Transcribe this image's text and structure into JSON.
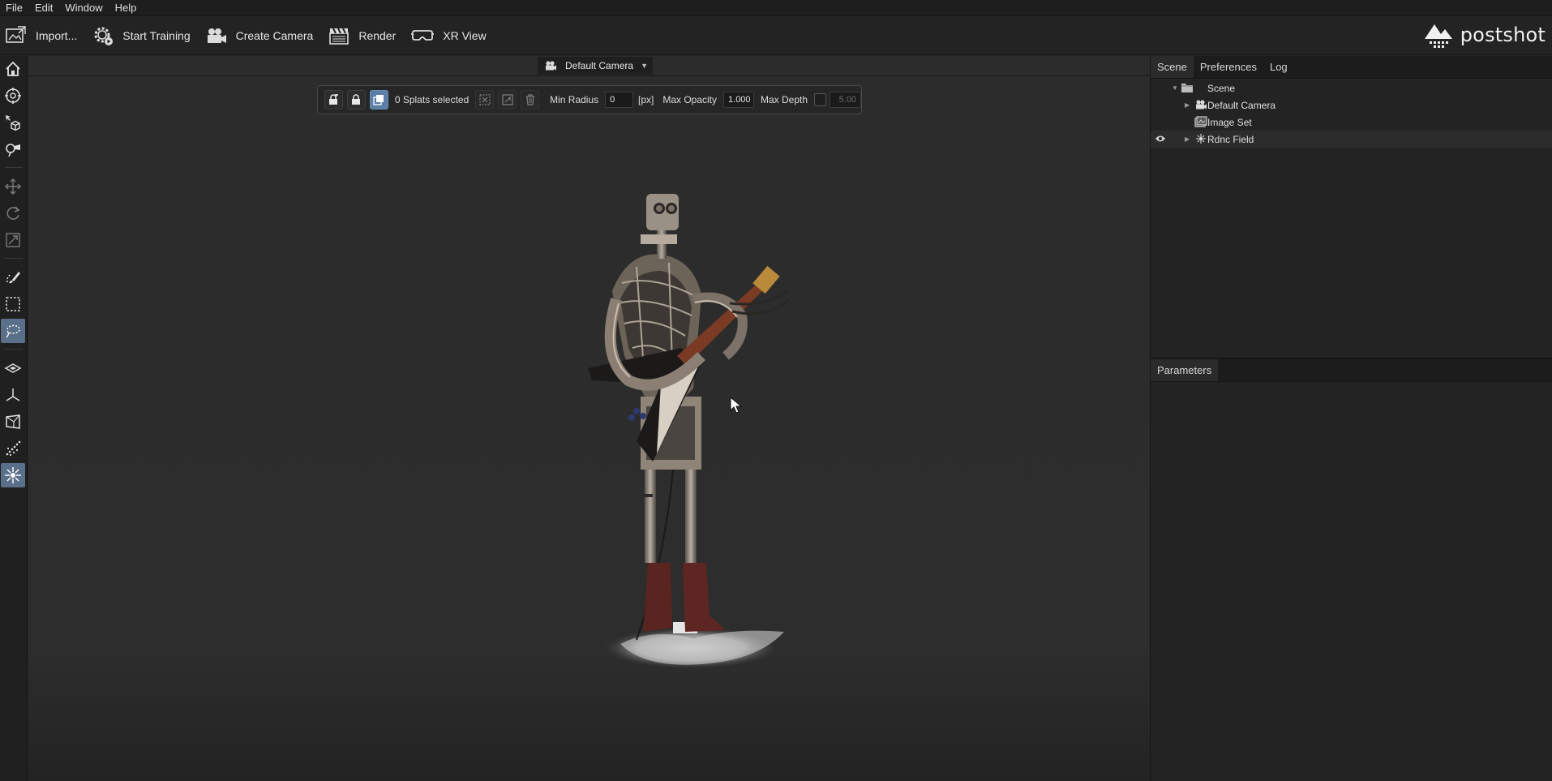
{
  "menu": [
    "File",
    "Edit",
    "Window",
    "Help"
  ],
  "toolbar": {
    "import": "Import...",
    "start_training": "Start Training",
    "create_camera": "Create Camera",
    "render": "Render",
    "xr_view": "XR View"
  },
  "brand": {
    "name": "postshot"
  },
  "viewport": {
    "camera_label": "Default Camera",
    "selection": {
      "count_text": "0 Splats selected",
      "min_radius_label": "Min Radius",
      "min_radius_value": "0",
      "unit": "[px]",
      "max_opacity_label": "Max Opacity",
      "max_opacity_value": "1.000",
      "max_depth_label": "Max Depth",
      "max_depth_value": "5.00",
      "max_depth_enabled": false
    }
  },
  "right_panel": {
    "tabs": [
      "Scene",
      "Preferences",
      "Log"
    ],
    "active_tab": "Scene",
    "tree": [
      {
        "label": "Scene",
        "level": 0,
        "expanded": true,
        "icon": "folder-icon"
      },
      {
        "label": "Default Camera",
        "level": 1,
        "expanded": false,
        "icon": "camera-icon"
      },
      {
        "label": "Image Set",
        "level": 1,
        "icon": "image-set-icon"
      },
      {
        "label": "Rdnc Field",
        "level": 1,
        "expanded": false,
        "icon": "radiance-field-icon",
        "visible": true
      }
    ],
    "params_tab": "Parameters"
  },
  "left_tools": [
    "home-icon",
    "orbit-icon",
    "select-object-icon",
    "fly-icon",
    "move-icon",
    "rotate-icon",
    "scale-icon",
    "brush-select-icon",
    "rect-select-icon",
    "lasso-select-icon",
    "ground-plane-icon",
    "axis-icon",
    "crop-box-icon",
    "point-cloud-icon",
    "radiance-field-icon"
  ],
  "colors": {
    "accent": "#5a7ea6",
    "background": "#2d2d2d",
    "panel": "#232323"
  }
}
